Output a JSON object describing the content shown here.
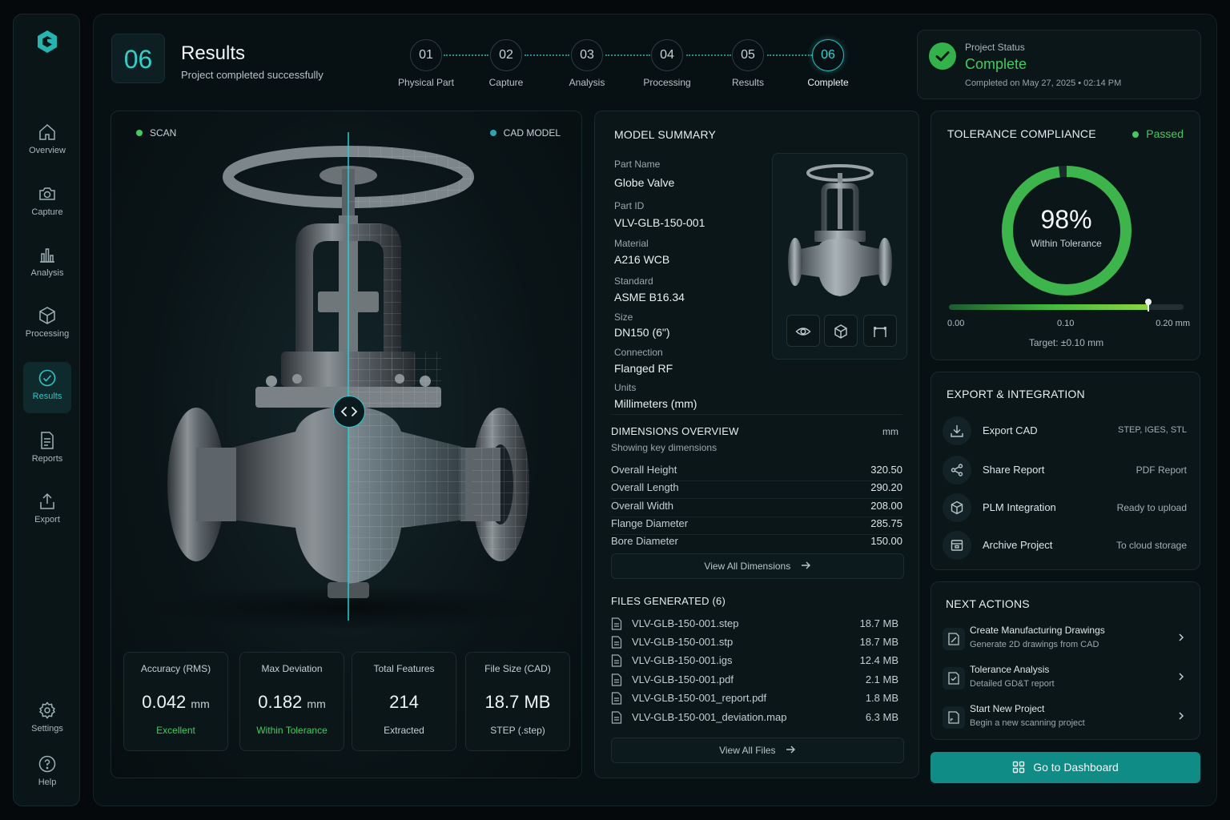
{
  "sidebar": {
    "items": [
      {
        "label": "Overview"
      },
      {
        "label": "Capture"
      },
      {
        "label": "Analysis"
      },
      {
        "label": "Processing"
      },
      {
        "label": "Results"
      },
      {
        "label": "Reports"
      },
      {
        "label": "Export"
      }
    ],
    "bottom": [
      {
        "label": "Settings"
      },
      {
        "label": "Help"
      }
    ],
    "active": "Results"
  },
  "header": {
    "step_number": "06",
    "title": "Results",
    "subtitle": "Project completed successfully"
  },
  "stepper": [
    {
      "num": "01",
      "label": "Physical Part"
    },
    {
      "num": "02",
      "label": "Capture"
    },
    {
      "num": "03",
      "label": "Analysis"
    },
    {
      "num": "04",
      "label": "Processing"
    },
    {
      "num": "05",
      "label": "Results"
    },
    {
      "num": "06",
      "label": "Complete"
    }
  ],
  "status": {
    "label": "Project Status",
    "value": "Complete",
    "date": "Completed on May 27, 2025 • 02:14 PM"
  },
  "viewer": {
    "scan_label": "SCAN",
    "cad_label": "CAD MODEL",
    "metrics": [
      {
        "label": "Accuracy (RMS)",
        "value": "0.042",
        "unit": "mm",
        "sub": "Excellent"
      },
      {
        "label": "Max Deviation",
        "value": "0.182",
        "unit": "mm",
        "sub": "Within Tolerance"
      },
      {
        "label": "Total Features",
        "value": "214",
        "unit": "",
        "sub": "Extracted"
      },
      {
        "label": "File Size (CAD)",
        "value": "18.7 MB",
        "unit": "",
        "sub": "STEP (.step)"
      }
    ]
  },
  "summary": {
    "title": "MODEL SUMMARY",
    "fields": [
      {
        "label": "Part Name",
        "value": "Globe Valve"
      },
      {
        "label": "Part ID",
        "value": "VLV-GLB-150-001"
      },
      {
        "label": "Material",
        "value": "A216 WCB"
      },
      {
        "label": "Standard",
        "value": "ASME B16.34"
      },
      {
        "label": "Size",
        "value": "DN150 (6\")"
      },
      {
        "label": "Connection",
        "value": "Flanged RF"
      },
      {
        "label": "Units",
        "value": "Millimeters (mm)"
      }
    ],
    "dimensions": {
      "title": "DIMENSIONS OVERVIEW",
      "unit": "mm",
      "subtitle": "Showing key dimensions",
      "rows": [
        {
          "name": "Overall Height",
          "value": "320.50"
        },
        {
          "name": "Overall Length",
          "value": "290.20"
        },
        {
          "name": "Overall Width",
          "value": "208.00"
        },
        {
          "name": "Flange Diameter",
          "value": "285.75"
        },
        {
          "name": "Bore Diameter",
          "value": "150.00"
        }
      ],
      "view_all": "View All Dimensions"
    },
    "files": {
      "title": "FILES GENERATED (6)",
      "rows": [
        {
          "name": "VLV-GLB-150-001.step",
          "size": "18.7 MB"
        },
        {
          "name": "VLV-GLB-150-001.stp",
          "size": "18.7 MB"
        },
        {
          "name": "VLV-GLB-150-001.igs",
          "size": "12.4 MB"
        },
        {
          "name": "VLV-GLB-150-001.pdf",
          "size": "2.1 MB"
        },
        {
          "name": "VLV-GLB-150-001_report.pdf",
          "size": "1.8 MB"
        },
        {
          "name": "VLV-GLB-150-001_deviation.map",
          "size": "6.3 MB"
        }
      ],
      "view_all": "View All Files"
    }
  },
  "tolerance": {
    "title": "TOLERANCE COMPLIANCE",
    "badge": "Passed",
    "percent": 98,
    "percent_text": "98%",
    "percent_label": "Within Tolerance",
    "scale": [
      "0.00",
      "0.10",
      "0.20 mm"
    ],
    "marker_value": 0.17,
    "scale_max": 0.2,
    "target": "Target: ±0.10 mm",
    "colors": {
      "ring": "#3cb54a",
      "accent": "#1fb5ad"
    }
  },
  "export": {
    "title": "EXPORT & INTEGRATION",
    "items": [
      {
        "name": "Export CAD",
        "note": "STEP, IGES, STL",
        "icon": "download-icon"
      },
      {
        "name": "Share Report",
        "note": "PDF Report",
        "icon": "share-icon"
      },
      {
        "name": "PLM Integration",
        "note": "Ready to upload",
        "icon": "cube-icon"
      },
      {
        "name": "Archive Project",
        "note": "To cloud storage",
        "icon": "archive-icon"
      }
    ]
  },
  "next_actions": {
    "title": "NEXT ACTIONS",
    "items": [
      {
        "title": "Create Manufacturing Drawings",
        "sub": "Generate 2D drawings from CAD"
      },
      {
        "title": "Tolerance Analysis",
        "sub": "Detailed GD&T report"
      },
      {
        "title": "Start New Project",
        "sub": "Begin a new scanning project"
      }
    ]
  },
  "dashboard_button": "Go to Dashboard"
}
